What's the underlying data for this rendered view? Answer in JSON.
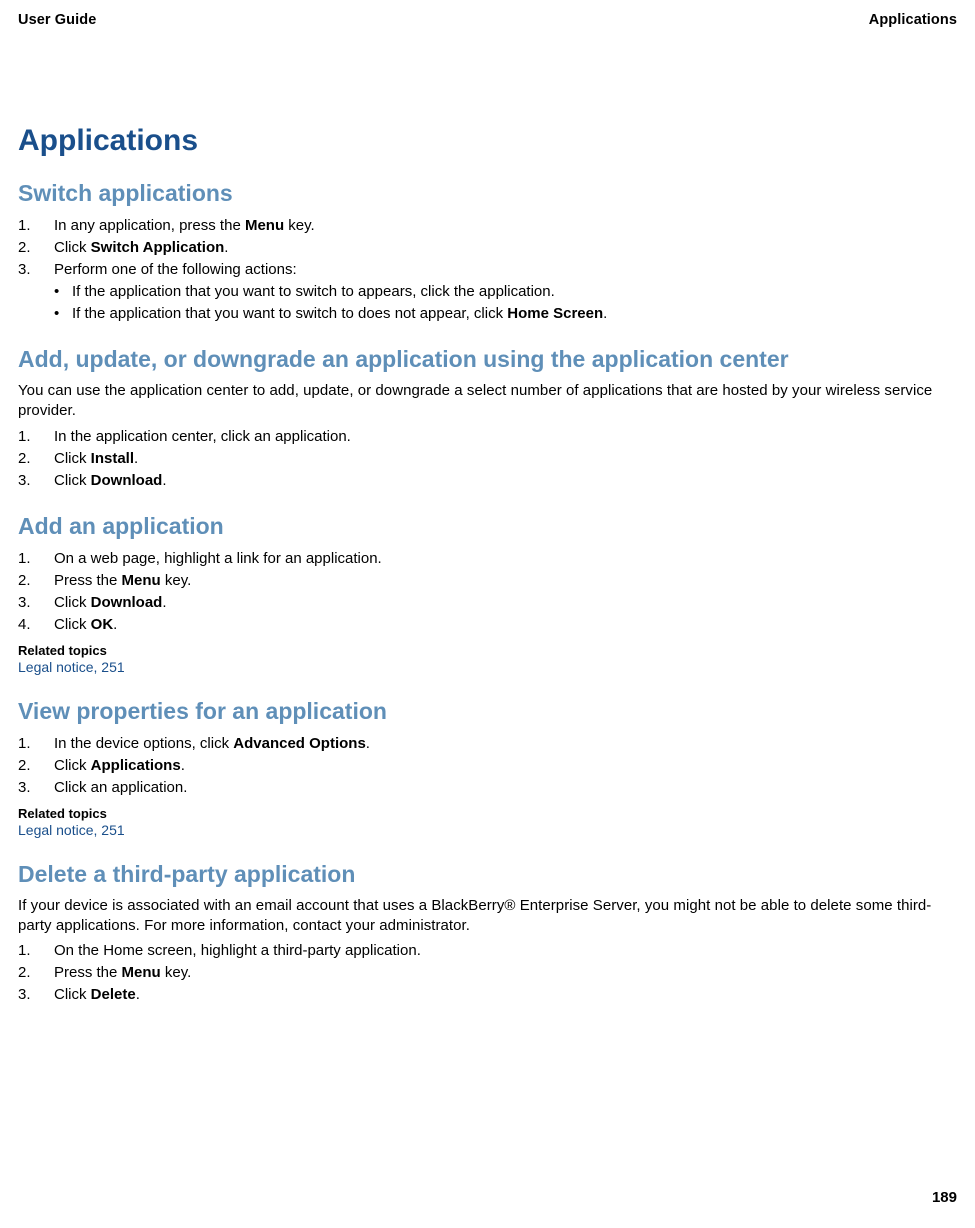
{
  "header": {
    "left": "User Guide",
    "right": "Applications"
  },
  "main_title": "Applications",
  "sections": {
    "switch": {
      "title": "Switch applications",
      "step1_prefix": "In any application, press the ",
      "step1_bold": "Menu",
      "step1_suffix": " key.",
      "step2_prefix": "Click ",
      "step2_bold": "Switch Application",
      "step2_suffix": ".",
      "step3": "Perform one of the following actions:",
      "bullet1": "If the application that you want to switch to appears, click the application.",
      "bullet2_prefix": "If the application that you want to switch to does not appear, click ",
      "bullet2_bold": "Home Screen",
      "bullet2_suffix": "."
    },
    "appcenter": {
      "title": "Add, update, or downgrade an application using the application center",
      "intro": "You can use the application center to add, update, or downgrade a select number of applications that are hosted by your wireless service provider.",
      "step1": "In the application center, click an application.",
      "step2_prefix": "Click ",
      "step2_bold": "Install",
      "step2_suffix": ".",
      "step3_prefix": "Click ",
      "step3_bold": "Download",
      "step3_suffix": "."
    },
    "addapp": {
      "title": "Add an application",
      "step1": "On a web page, highlight a link for an application.",
      "step2_prefix": "Press the ",
      "step2_bold": "Menu",
      "step2_suffix": " key.",
      "step3_prefix": "Click ",
      "step3_bold": "Download",
      "step3_suffix": ".",
      "step4_prefix": "Click ",
      "step4_bold": "OK",
      "step4_suffix": ".",
      "related_heading": "Related topics",
      "related_link": "Legal notice, 251"
    },
    "viewprops": {
      "title": "View properties for an application",
      "step1_prefix": "In the device options, click ",
      "step1_bold": "Advanced Options",
      "step1_suffix": ".",
      "step2_prefix": "Click ",
      "step2_bold": "Applications",
      "step2_suffix": ".",
      "step3": "Click an application.",
      "related_heading": "Related topics",
      "related_link": "Legal notice, 251"
    },
    "delete": {
      "title": "Delete a third-party application",
      "intro": "If your device is associated with an email account that uses a BlackBerry® Enterprise Server, you might not be able to delete some third-party applications. For more information, contact your administrator.",
      "step1": "On the Home screen, highlight a third-party application.",
      "step2_prefix": "Press the ",
      "step2_bold": "Menu",
      "step2_suffix": " key.",
      "step3_prefix": "Click ",
      "step3_bold": "Delete",
      "step3_suffix": "."
    }
  },
  "page_number": "189"
}
